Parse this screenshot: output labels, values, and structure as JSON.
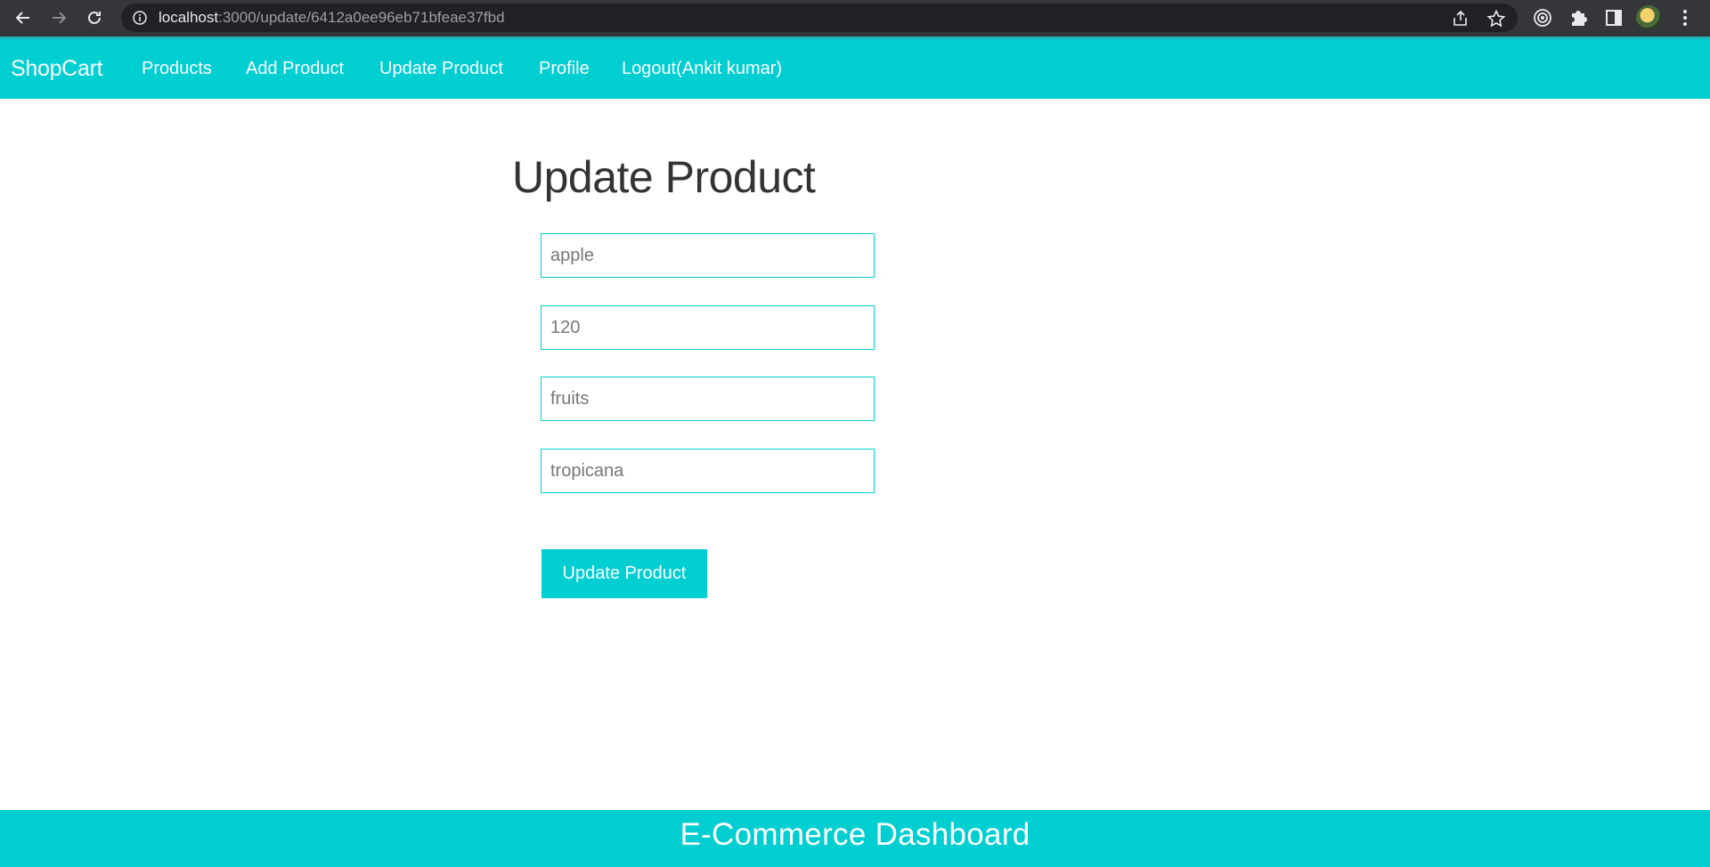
{
  "browser": {
    "url_host": "localhost",
    "url_path": ":3000/update/6412a0ee96eb71bfeae37fbd",
    "icons": [
      "back-arrow-icon",
      "forward-arrow-icon",
      "reload-icon",
      "info-icon",
      "share-icon",
      "star-icon",
      "extension-target-icon",
      "puzzle-icon",
      "side-panel-icon",
      "menu-dots-icon"
    ]
  },
  "navbar": {
    "brand": "ShopCart",
    "links": [
      {
        "label": "Products"
      },
      {
        "label": "Add Product"
      },
      {
        "label": "Update Product"
      },
      {
        "label": "Profile"
      },
      {
        "label": "Logout(Ankit kumar)"
      }
    ]
  },
  "form": {
    "title": "Update Product",
    "fields": [
      {
        "value": "apple"
      },
      {
        "value": "120"
      },
      {
        "value": "fruits"
      },
      {
        "value": "tropicana"
      }
    ],
    "submit_label": "Update Product"
  },
  "footer": {
    "text": "E-Commerce Dashboard"
  },
  "colors": {
    "accent": "#00ced1",
    "chrome_bg": "#35363a",
    "omnibox_bg": "#202124"
  }
}
